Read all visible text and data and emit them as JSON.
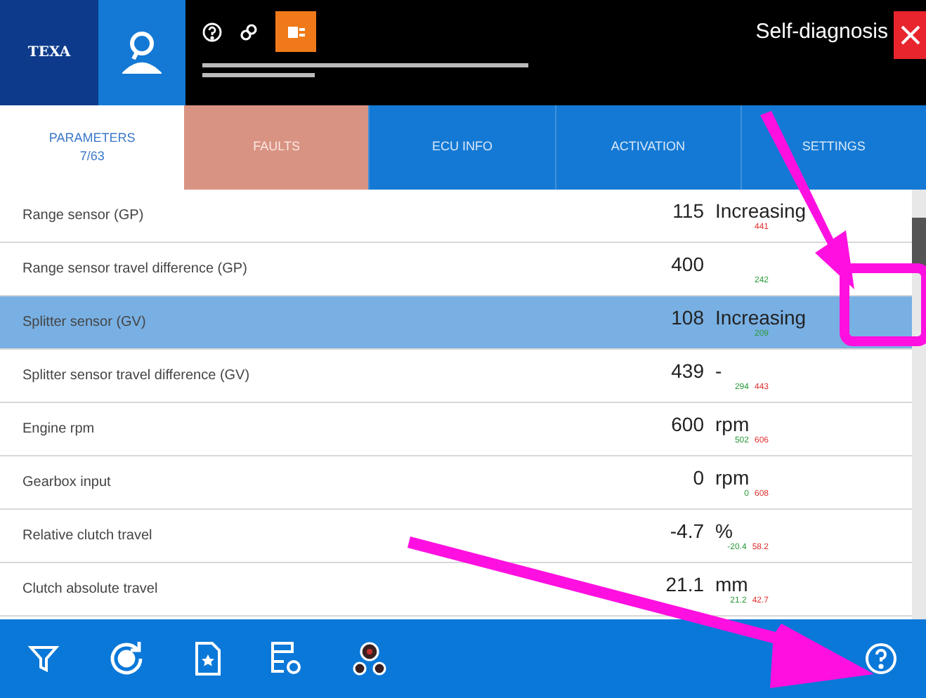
{
  "header": {
    "brand": "TEXA",
    "title": "Self-diagnosis"
  },
  "tabs": [
    {
      "label": "PARAMETERS",
      "sub": "7/63",
      "selected": true,
      "alert": false
    },
    {
      "label": "FAULTS",
      "selected": false,
      "alert": true
    },
    {
      "label": "ECU INFO",
      "selected": false,
      "alert": false
    },
    {
      "label": "ACTIVATION",
      "selected": false,
      "alert": false
    },
    {
      "label": "SETTINGS",
      "selected": false,
      "alert": false
    }
  ],
  "rows": [
    {
      "name": "Range sensor (GP)",
      "value": "115",
      "unit": "Increasing",
      "min": "",
      "max": "441",
      "selected": false
    },
    {
      "name": "Range sensor travel difference (GP)",
      "value": "400",
      "unit": "",
      "min": "242",
      "max": "",
      "selected": false
    },
    {
      "name": "Splitter sensor (GV)",
      "value": "108",
      "unit": "Increasing",
      "min": "209",
      "max": "",
      "selected": true
    },
    {
      "name": "Splitter sensor travel difference (GV)",
      "value": "439",
      "unit": "-",
      "min": "294",
      "max": "443",
      "selected": false
    },
    {
      "name": "Engine rpm",
      "value": "600",
      "unit": "rpm",
      "min": "502",
      "max": "606",
      "selected": false
    },
    {
      "name": "Gearbox input",
      "value": "0",
      "unit": "rpm",
      "min": "0",
      "max": "608",
      "selected": false
    },
    {
      "name": "Relative clutch travel",
      "value": "-4.7",
      "unit": "%",
      "min": "-20.4",
      "max": "58.2",
      "selected": false
    },
    {
      "name": "Clutch absolute travel",
      "value": "21.1",
      "unit": "mm",
      "min": "21.2",
      "max": "42.7",
      "selected": false
    }
  ]
}
